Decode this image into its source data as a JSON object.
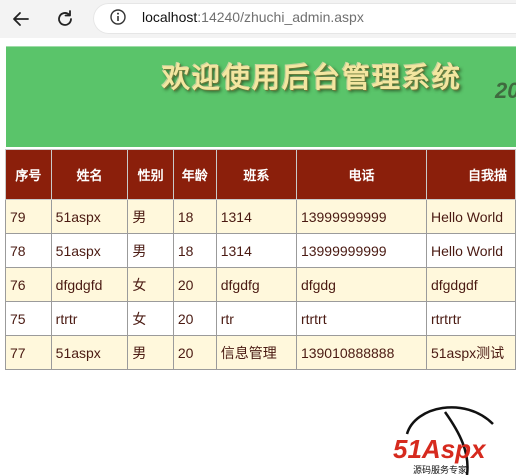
{
  "browser": {
    "url_host": "localhost",
    "url_rest": ":14240/zhuchi_admin.aspx"
  },
  "banner": {
    "title": "欢迎使用后台管理系统",
    "year_fragment": "20"
  },
  "table": {
    "columns": [
      "序号",
      "姓名",
      "性别",
      "年龄",
      "班系",
      "电话",
      "自我描"
    ],
    "rows": [
      [
        "79",
        "51aspx",
        "男",
        "18",
        "1314",
        "13999999999",
        "Hello World"
      ],
      [
        "78",
        "51aspx",
        "男",
        "18",
        "1314",
        "13999999999",
        "Hello World"
      ],
      [
        "76",
        "dfgdgfd",
        "女",
        "20",
        "dfgdfg",
        "dfgdg",
        "dfgdgdf"
      ],
      [
        "75",
        "rtrtr",
        "女",
        "20",
        "rtr",
        "rtrtrt",
        "rtrtrtr"
      ],
      [
        "77",
        "51aspx",
        "男",
        "20",
        "信息管理",
        "139010888888",
        "51aspx测试"
      ]
    ]
  },
  "logo": {
    "text": "51Aspx",
    "subtext": "源码服务专家"
  },
  "colors": {
    "banner_green": "#5ac46a",
    "header_red": "#8b1f0b",
    "row_cream": "#fff8dc",
    "logo_red": "#d62a1e"
  }
}
